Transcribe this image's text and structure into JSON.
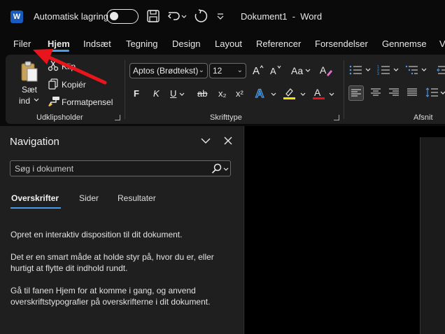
{
  "titlebar": {
    "app_logo": "W",
    "autosave_label": "Automatisk lagring",
    "document_title": "Dokument1  -  Word",
    "icons": [
      "save-icon",
      "undo-icon",
      "redo-icon",
      "customize-quick-access-icon"
    ]
  },
  "ribbon_tabs": [
    "Filer",
    "Hjem",
    "Indsæt",
    "Tegning",
    "Design",
    "Layout",
    "Referencer",
    "Forsendelser",
    "Gennemse",
    "V"
  ],
  "active_tab": "Hjem",
  "clipboard": {
    "paste_label_line1": "Sæt",
    "paste_label_line2": "ind",
    "cut_label": "Klip",
    "copy_label": "Kopiér",
    "format_painter_label": "Formatpensel",
    "group_label": "Udklipsholder"
  },
  "font": {
    "font_name": "Aptos (Brødtekst)",
    "font_size": "12",
    "bold": "F",
    "italic": "K",
    "underline": "U",
    "strikethrough": "ab",
    "subscript": "x₂",
    "superscript": "x²",
    "change_case": "Aa",
    "group_label": "Skrifttype",
    "highlight_color": "#f5e400",
    "font_color": "#e81123"
  },
  "paragraph": {
    "group_label": "Afsnit"
  },
  "navigation": {
    "title": "Navigation",
    "search_placeholder": "Søg i dokument",
    "tabs": [
      "Overskrifter",
      "Sider",
      "Resultater"
    ],
    "active_tab": "Overskrifter",
    "text1": "Opret en interaktiv disposition til dit dokument.",
    "text2": "Det er en smart måde at holde styr på, hvor du er, eller hurtigt at flytte dit indhold rundt.",
    "text3": "Gå til fanen Hjem for at komme i gang, og anvend overskriftstypografier på overskrifterne i dit dokument."
  },
  "colors": {
    "accent": "#4c9be8",
    "annotation_arrow": "#e8161c",
    "word_brand": "#185abd"
  }
}
